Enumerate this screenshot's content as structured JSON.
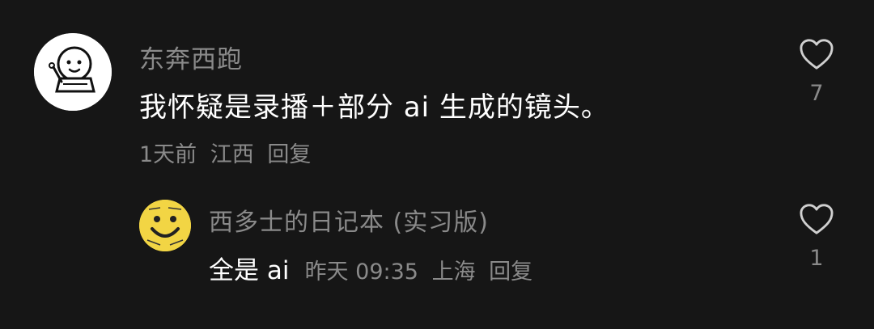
{
  "comment": {
    "username": "东奔西跑",
    "text": "我怀疑是录播＋部分 ai 生成的镜头。",
    "time": "1天前",
    "location": "江西",
    "reply_label": "回复",
    "likes": "7",
    "avatar_icon": "smiley-writing-icon"
  },
  "reply": {
    "username": "西多士的日记本 (实习版)",
    "text": "全是 ai",
    "time": "昨天 09:35",
    "location": "上海",
    "reply_label": "回复",
    "likes": "1",
    "avatar_icon": "yellow-smiley-icon"
  },
  "colors": {
    "background": "#161616",
    "primary_text": "#ffffff",
    "secondary_text": "#8a8a8a",
    "avatar_yellow": "#f2d544"
  }
}
